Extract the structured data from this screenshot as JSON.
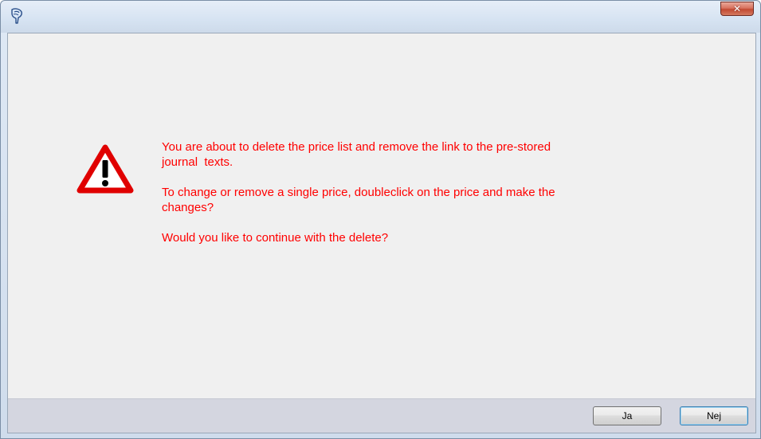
{
  "window": {
    "title": "",
    "close_glyph": "✕"
  },
  "icons": {
    "app": "app-logo-icon",
    "warning": "warning-triangle-icon"
  },
  "colors": {
    "message_text": "#ff0000",
    "warning_border": "#e00000",
    "button_bar": "#d4d6e0"
  },
  "message": {
    "paragraphs": [
      "You are about to delete the price list and remove the link to the pre-stored\njournal  texts.",
      "To change or remove a single price, doubleclick on the price and make the\nchanges?",
      "Would you like to continue with the delete?"
    ]
  },
  "buttons": {
    "yes_label": "Ja",
    "no_label": "Nej"
  }
}
